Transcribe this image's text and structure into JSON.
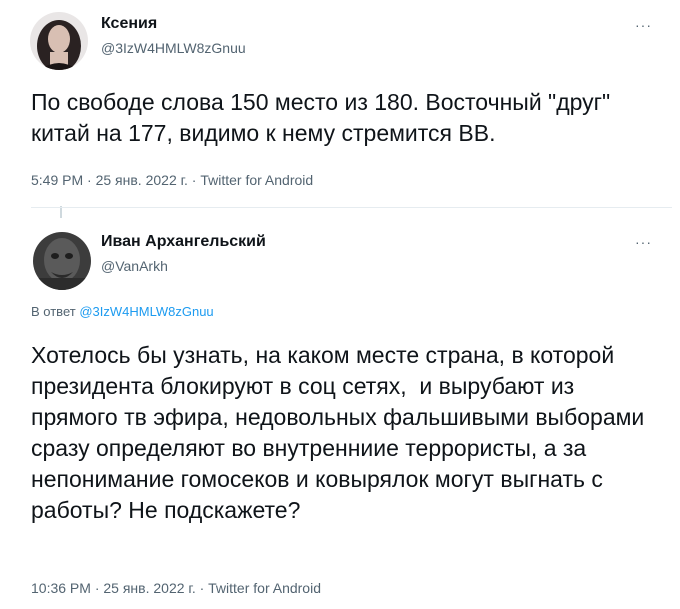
{
  "tweets": [
    {
      "name": "Ксения",
      "handle": "@3IzW4HMLW8zGnuu",
      "more": "···",
      "text": "По свободе слова 150 место из 180. Восточный \"друг\" китай на 177, видимо к нему стремится ВВ.",
      "time": "5:49 PM",
      "date": "25 янв. 2022 г.",
      "source": "Twitter for Android",
      "sep": "·"
    },
    {
      "name": "Иван Архангельский",
      "handle": "@VanArkh",
      "more": "···",
      "reply_prefix": "В ответ",
      "reply_handle": "@3IzW4HMLW8zGnuu",
      "text": "Хотелось бы узнать, на каком месте страна, в которой  президента блокируют в соц сетях,  и вырубают из прямого тв эфира, недовольных фальшивыми выборами сразу определяют во внутренниие террористы, а за непонимание гомосеков и ковырялок могут выгнать с работы? Не подскажете?",
      "time": "10:36 PM",
      "date": "25 янв. 2022 г.",
      "source": "Twitter for Android",
      "sep": "·"
    }
  ],
  "colors": {
    "text": "#0f1419",
    "muted": "#536471",
    "link": "#1d9bf0",
    "divider": "#e6ecf0"
  }
}
